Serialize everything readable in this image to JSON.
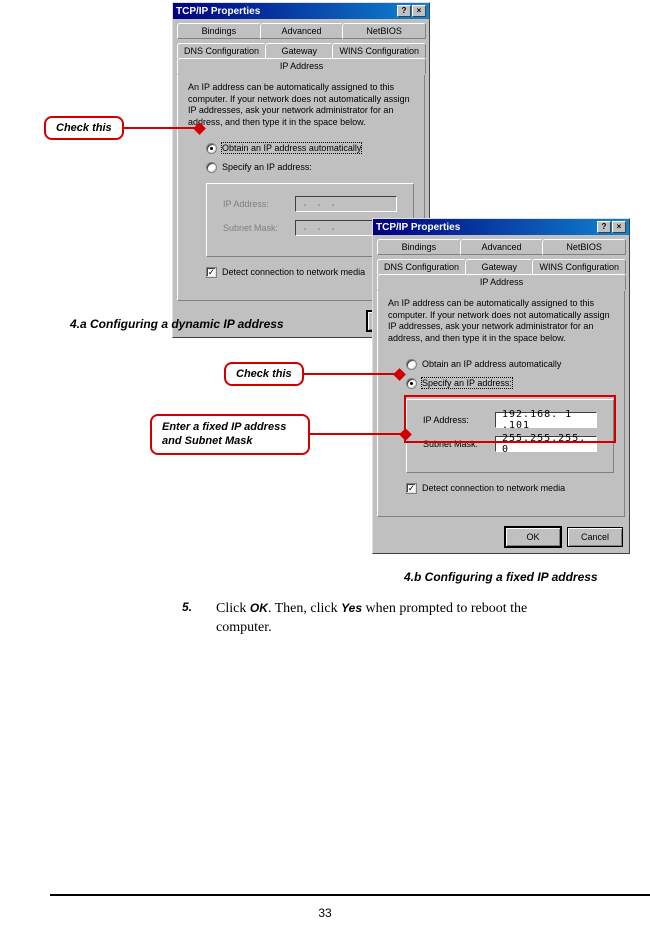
{
  "dialog": {
    "title": "TCP/IP Properties",
    "help_glyph": "?",
    "close_glyph": "×",
    "tabs_row1": [
      "Bindings",
      "Advanced",
      "NetBIOS"
    ],
    "tabs_row2": [
      "DNS Configuration",
      "Gateway",
      "WINS Configuration",
      "IP Address"
    ],
    "instruction": "An IP address can be automatically assigned to this computer. If your network does not automatically assign IP addresses, ask your network administrator for an address, and then type it in the space below.",
    "radio_auto": "Obtain an IP address automatically",
    "radio_specify": "Specify an IP address:",
    "ip_label": "IP Address:",
    "mask_label": "Subnet Mask:",
    "ip_placeholder": ".   .   .",
    "detect_label": "Detect connection to network media",
    "check_glyph": "✓",
    "ok_label": "OK",
    "cancel_label": "Cancel"
  },
  "dialog_b": {
    "ip_value": "192.168. 1 .101",
    "mask_value": "255.255.255. 0"
  },
  "callouts": {
    "check_this": "Check this",
    "enter_fixed": "Enter a fixed IP address and Subnet Mask"
  },
  "captions": {
    "a": "4.a Configuring a dynamic IP address",
    "b": "4.b Configuring a fixed IP address"
  },
  "step": {
    "num": "5.",
    "prefix": "Click ",
    "btn1": "OK",
    "mid": ".  Then, click ",
    "btn2": "Yes",
    "suffix": " when prompted to reboot the computer."
  },
  "page_number": "33"
}
